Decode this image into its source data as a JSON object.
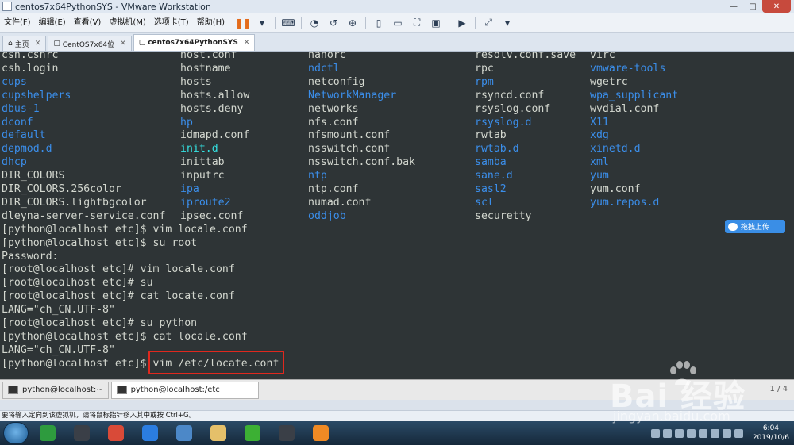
{
  "window": {
    "title": "centos7x64PythonSYS - VMware Workstation",
    "controls": {
      "minimize": "—",
      "maximize": "□",
      "close": "✕"
    }
  },
  "menu": [
    "文件(F)",
    "编辑(E)",
    "查看(V)",
    "虚拟机(M)",
    "选项卡(T)",
    "帮助(H)"
  ],
  "toolbar_icons": [
    "pause-icon",
    "dropdown-icon",
    "send-keys-icon",
    "snapshot-icon",
    "revert-snapshot-icon",
    "snapshot-manager-icon",
    "sidebar-icon",
    "thumbnail-icon",
    "fullscreen-icon",
    "unity-icon",
    "console-icon",
    "stretch-icon"
  ],
  "tabs": [
    {
      "label": "主页",
      "icon": "home-icon",
      "active": false
    },
    {
      "label": "CentOS7x64位",
      "icon": "vm-icon",
      "active": false
    },
    {
      "label": "centos7x64PythonSYS",
      "icon": "vm-icon",
      "active": true
    }
  ],
  "terminal": {
    "columns": [
      [
        {
          "t": "csh.cshrc",
          "k": "w"
        },
        {
          "t": "csh.login",
          "k": "w"
        },
        {
          "t": "cups",
          "k": "b"
        },
        {
          "t": "cupshelpers",
          "k": "b"
        },
        {
          "t": "dbus-1",
          "k": "b"
        },
        {
          "t": "dconf",
          "k": "b"
        },
        {
          "t": "default",
          "k": "b"
        },
        {
          "t": "depmod.d",
          "k": "b"
        },
        {
          "t": "dhcp",
          "k": "b"
        },
        {
          "t": "DIR_COLORS",
          "k": "w"
        },
        {
          "t": "DIR_COLORS.256color",
          "k": "w"
        },
        {
          "t": "DIR_COLORS.lightbgcolor",
          "k": "w"
        },
        {
          "t": "dleyna-server-service.conf",
          "k": "w"
        }
      ],
      [
        {
          "t": "host.conf",
          "k": "w"
        },
        {
          "t": "hostname",
          "k": "w"
        },
        {
          "t": "hosts",
          "k": "w"
        },
        {
          "t": "hosts.allow",
          "k": "w"
        },
        {
          "t": "hosts.deny",
          "k": "w"
        },
        {
          "t": "hp",
          "k": "b"
        },
        {
          "t": "idmapd.conf",
          "k": "w"
        },
        {
          "t": "init.d",
          "k": "c"
        },
        {
          "t": "inittab",
          "k": "w"
        },
        {
          "t": "inputrc",
          "k": "w"
        },
        {
          "t": "ipa",
          "k": "b"
        },
        {
          "t": "iproute2",
          "k": "b"
        },
        {
          "t": "ipsec.conf",
          "k": "w"
        }
      ],
      [
        {
          "t": "nanorc",
          "k": "w"
        },
        {
          "t": "ndctl",
          "k": "b"
        },
        {
          "t": "netconfig",
          "k": "w"
        },
        {
          "t": "NetworkManager",
          "k": "b"
        },
        {
          "t": "networks",
          "k": "w"
        },
        {
          "t": "nfs.conf",
          "k": "w"
        },
        {
          "t": "nfsmount.conf",
          "k": "w"
        },
        {
          "t": "nsswitch.conf",
          "k": "w"
        },
        {
          "t": "nsswitch.conf.bak",
          "k": "w"
        },
        {
          "t": "ntp",
          "k": "b"
        },
        {
          "t": "ntp.conf",
          "k": "w"
        },
        {
          "t": "numad.conf",
          "k": "w"
        },
        {
          "t": "oddjob",
          "k": "b"
        }
      ],
      [
        {
          "t": "resolv.conf.save",
          "k": "w"
        },
        {
          "t": "rpc",
          "k": "w"
        },
        {
          "t": "rpm",
          "k": "b"
        },
        {
          "t": "rsyncd.conf",
          "k": "w"
        },
        {
          "t": "rsyslog.conf",
          "k": "w"
        },
        {
          "t": "rsyslog.d",
          "k": "b"
        },
        {
          "t": "rwtab",
          "k": "w"
        },
        {
          "t": "rwtab.d",
          "k": "b"
        },
        {
          "t": "samba",
          "k": "b"
        },
        {
          "t": "sane.d",
          "k": "b"
        },
        {
          "t": "sasl2",
          "k": "b"
        },
        {
          "t": "scl",
          "k": "b"
        },
        {
          "t": "securetty",
          "k": "w"
        }
      ],
      [
        {
          "t": "virc",
          "k": "w"
        },
        {
          "t": "vmware-tools",
          "k": "b"
        },
        {
          "t": "wgetrc",
          "k": "w"
        },
        {
          "t": "wpa_supplicant",
          "k": "b"
        },
        {
          "t": "wvdial.conf",
          "k": "w"
        },
        {
          "t": "X11",
          "k": "b"
        },
        {
          "t": "xdg",
          "k": "b"
        },
        {
          "t": "xinetd.d",
          "k": "b"
        },
        {
          "t": "xml",
          "k": "b"
        },
        {
          "t": "yum",
          "k": "b"
        },
        {
          "t": "yum.conf",
          "k": "w"
        },
        {
          "t": "yum.repos.d",
          "k": "b"
        }
      ]
    ],
    "lines": [
      "[python@localhost etc]$ vim locale.conf",
      "[python@localhost etc]$ su root",
      "Password:",
      "[root@localhost etc]# vim locale.conf",
      "[root@localhost etc]# su",
      "[root@localhost etc]# cat locate.conf",
      "LANG=\"ch_CN.UTF-8\"",
      "[root@localhost etc]# su python",
      "[python@localhost etc]$ cat locale.conf",
      "LANG=\"ch_CN.UTF-8\"",
      "[python@localhost etc]$ vim /etc/locate.conf"
    ]
  },
  "upload_button": "拖拽上传",
  "terminal_tabs": [
    {
      "label": "python@localhost:~",
      "active": false
    },
    {
      "label": "python@localhost:/etc",
      "active": true
    }
  ],
  "page_indicator": "1 / 4",
  "statusbar": "要将输入定向到该虚拟机，请将鼠标指针移入其中或按 Ctrl+G。",
  "taskbar": {
    "apps": [
      {
        "name": "tray-app-1",
        "color": "#2e9b3e"
      },
      {
        "name": "nox-icon",
        "color": "#3a3f47"
      },
      {
        "name": "chrome-icon",
        "color": "#d94a38"
      },
      {
        "name": "feather-icon",
        "color": "#2b7de1"
      },
      {
        "name": "desktop-icon",
        "color": "#4c88c8"
      },
      {
        "name": "folder-icon",
        "color": "#e5c06a"
      },
      {
        "name": "wechat-icon",
        "color": "#3cb034"
      },
      {
        "name": "nox-icon-2",
        "color": "#3a3f47"
      },
      {
        "name": "vmware-icon",
        "color": "#f08a24"
      }
    ],
    "time": "6:04",
    "date": "2019/10/6"
  },
  "watermark": {
    "brand": "Bai  经验",
    "url": "jingyan.baidu.com"
  }
}
